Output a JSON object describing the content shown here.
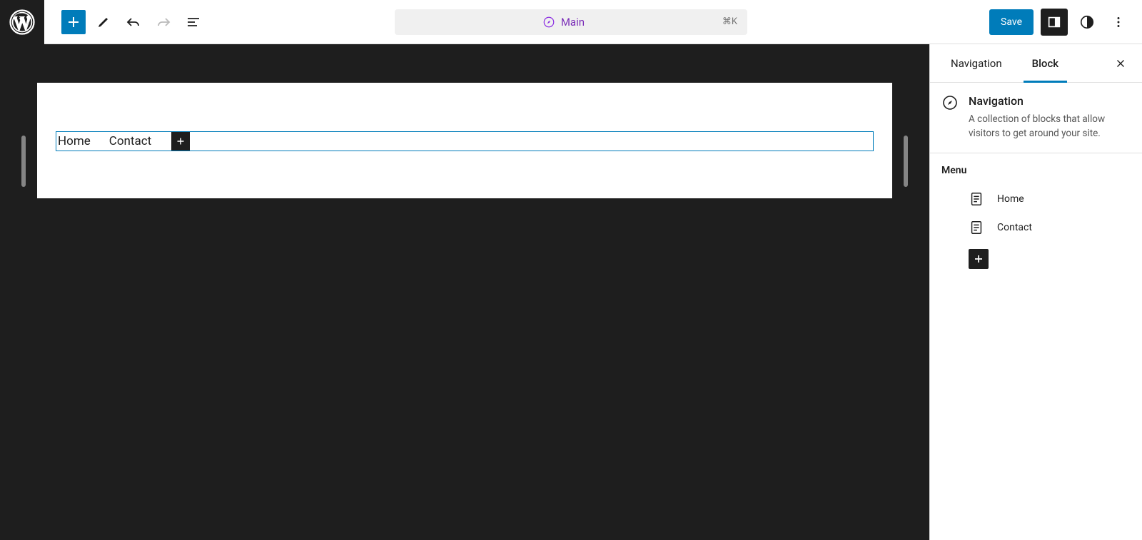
{
  "toolbar": {
    "center_label": "Main",
    "center_shortcut": "⌘K",
    "save_label": "Save"
  },
  "canvas": {
    "nav_items": [
      "Home",
      "Contact"
    ]
  },
  "sidebar": {
    "tabs": [
      "Navigation",
      "Block"
    ],
    "active_tab": 1,
    "block": {
      "title": "Navigation",
      "description": "A collection of blocks that allow visitors to get around your site."
    },
    "menu": {
      "title": "Menu",
      "items": [
        "Home",
        "Contact"
      ]
    }
  }
}
